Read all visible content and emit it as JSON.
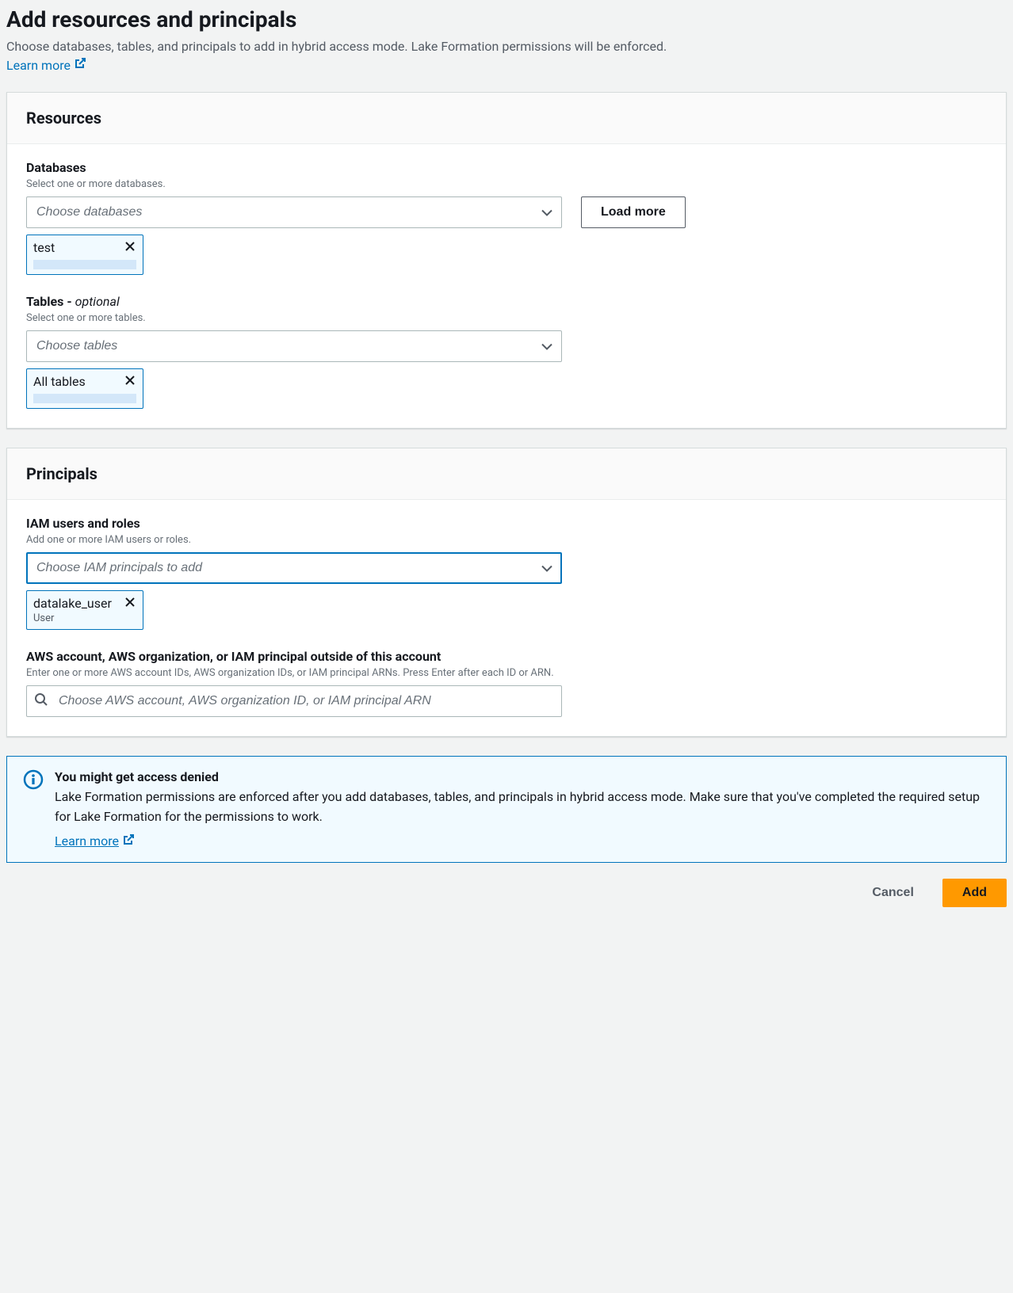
{
  "page": {
    "title": "Add resources and principals",
    "description": "Choose databases, tables, and principals to add in hybrid access mode. Lake Formation permissions will be enforced.",
    "learn_more": "Learn more"
  },
  "resources": {
    "title": "Resources",
    "databases": {
      "label": "Databases",
      "description": "Select one or more databases.",
      "placeholder": "Choose databases",
      "load_more": "Load more",
      "selected": [
        {
          "label": "test"
        }
      ]
    },
    "tables": {
      "label": "Tables - ",
      "optional": "optional",
      "description": "Select one or more tables.",
      "placeholder": "Choose tables",
      "selected": [
        {
          "label": "All tables"
        }
      ]
    }
  },
  "principals": {
    "title": "Principals",
    "iam": {
      "label": "IAM users and roles",
      "description": "Add one or more IAM users or roles.",
      "placeholder": "Choose IAM principals to add",
      "selected": [
        {
          "label": "datalake_user",
          "sublabel": "User"
        }
      ]
    },
    "external": {
      "label": "AWS account, AWS organization, or IAM principal outside of this account",
      "description": "Enter one or more AWS account IDs, AWS organization IDs, or IAM principal ARNs. Press Enter after each ID or ARN.",
      "placeholder": "Choose AWS account, AWS organization ID, or IAM principal ARN"
    }
  },
  "alert": {
    "title": "You might get access denied",
    "text": "Lake Formation permissions are enforced after you add databases, tables, and principals in hybrid access mode. Make sure that you've completed the required setup for Lake Formation for the permissions to work.",
    "learn_more": "Learn more "
  },
  "footer": {
    "cancel": "Cancel",
    "add": "Add"
  }
}
